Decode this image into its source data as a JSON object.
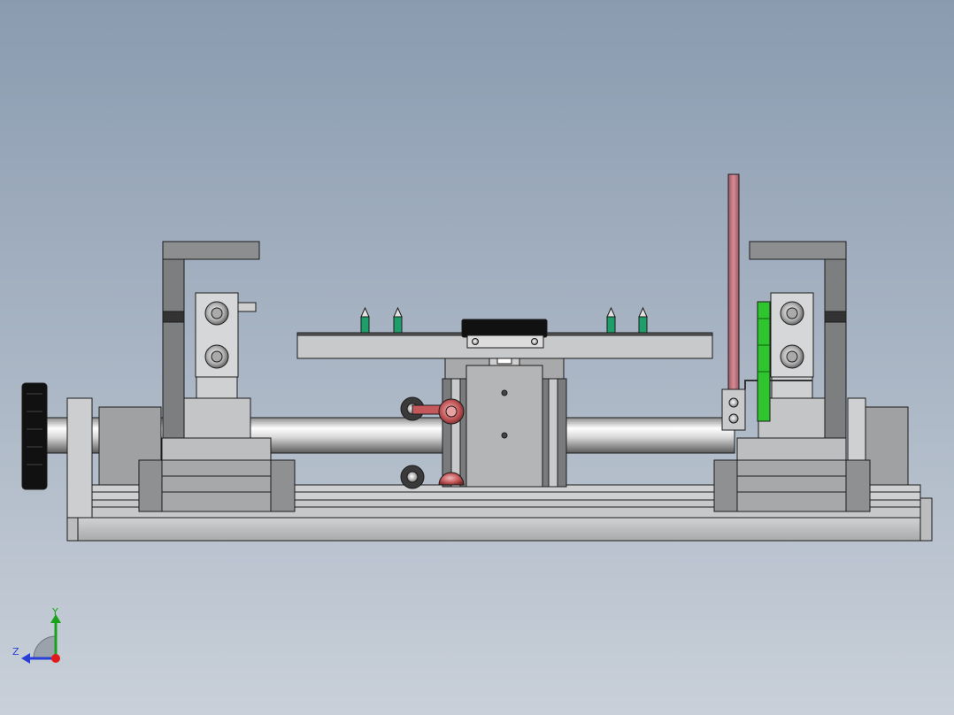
{
  "viewport": {
    "background_top": "#8a9bb0",
    "background_bottom": "#c9d0d9"
  },
  "colors": {
    "metal": "#b9babb",
    "metal_dark": "#6e6f70",
    "outline": "#1c1c1c",
    "knob": "#111111",
    "pin_green": "#1d9e6a",
    "clamp_red": "#c4585a",
    "indicator_red": "#b8707a",
    "spring_green": "#2ec52e",
    "axis_x": "#e01b1b",
    "axis_y": "#1aa31a",
    "axis_z": "#2a3fd6"
  },
  "model": {
    "parts": [
      "base-rail",
      "lower-rail",
      "adjust-knob",
      "shaft",
      "left-bracket",
      "right-bracket",
      "left-carriage",
      "right-carriage",
      "top-plate",
      "center-block",
      "locating-pins",
      "clamp-rollers",
      "indicator-rod",
      "green-spring"
    ]
  },
  "triad": {
    "y_label": "Y",
    "z_label": "Z",
    "x_icon": "red-dot-x-axis-icon"
  }
}
